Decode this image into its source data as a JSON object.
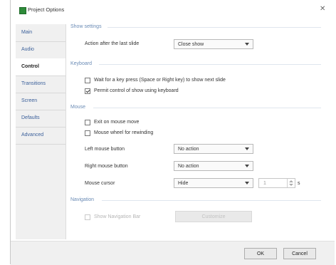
{
  "window": {
    "title": "Project Options",
    "close_icon": "close-icon"
  },
  "sidebar": {
    "items": [
      {
        "label": "Main"
      },
      {
        "label": "Audio"
      },
      {
        "label": "Control"
      },
      {
        "label": "Transitions"
      },
      {
        "label": "Screen"
      },
      {
        "label": "Defaults"
      },
      {
        "label": "Advanced"
      }
    ],
    "active": "Control"
  },
  "show_settings": {
    "heading": "Show settings",
    "action_after_label": "Action after the last slide",
    "action_after_value": "Close show"
  },
  "keyboard": {
    "heading": "Keyboard",
    "wait_key_label": "Wait for a key press (Space or Right key) to show next slide",
    "wait_key_checked": false,
    "permit_control_label": "Permit control of show using keyboard",
    "permit_control_checked": true
  },
  "mouse": {
    "heading": "Mouse",
    "exit_on_move_label": "Exit on mouse move",
    "exit_on_move_checked": false,
    "wheel_rewind_label": "Mouse wheel for rewinding",
    "wheel_rewind_checked": false,
    "left_button_label": "Left mouse button",
    "left_button_value": "No action",
    "right_button_label": "Right mouse button",
    "right_button_value": "No action",
    "cursor_label": "Mouse cursor",
    "cursor_value": "Hide",
    "cursor_seconds_value": "1",
    "cursor_unit": "s"
  },
  "navigation": {
    "heading": "Navigation",
    "show_bar_label": "Show Navigation Bar",
    "customize_label": "Customize"
  },
  "footer": {
    "ok_label": "OK",
    "cancel_label": "Cancel"
  },
  "colors": {
    "accent": "#6a8bb5",
    "sidebar_bg": "#f0f0f0",
    "footer_bg": "#f0f0f0"
  }
}
